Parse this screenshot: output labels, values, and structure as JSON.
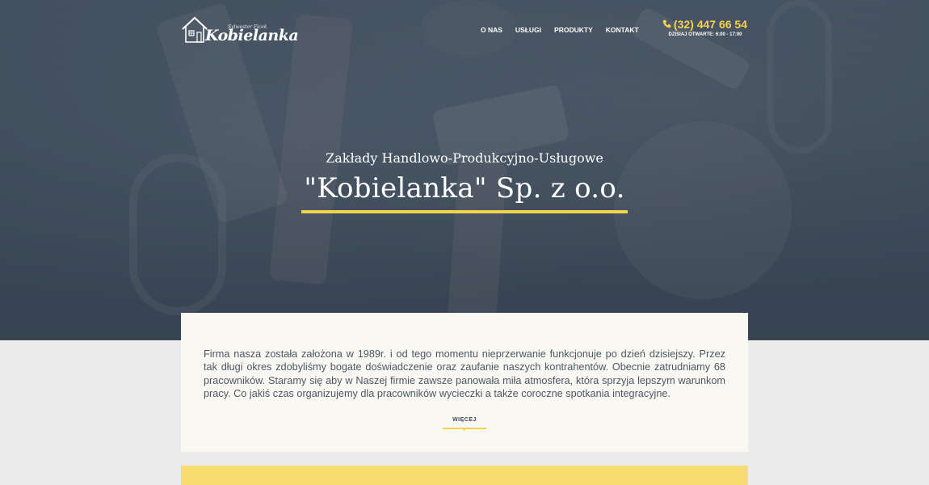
{
  "header": {
    "logo": {
      "subtitle": "Sylwester Ficek",
      "name": "Kobielanka",
      "icon": "house-icon"
    },
    "nav": [
      {
        "label": "O NAS"
      },
      {
        "label": "USŁUGI"
      },
      {
        "label": "PRODUKTY"
      },
      {
        "label": "KONTAKT"
      }
    ],
    "phone": {
      "icon": "phone-icon",
      "number": "(32) 447 66 54",
      "hours": "DZISIAJ OTWARTE: 6:00 - 17:00"
    }
  },
  "hero": {
    "subtitle": "Zakłady Handlowo-Produkcyjno-Usługowe",
    "title": "\"Kobielanka\" Sp. z o.o.",
    "accent_color": "#f3d24e"
  },
  "about": {
    "text": "Firma nasza została założona w 1989r. i od tego momentu nieprzerwanie funkcjonuje po dzień dzisiejszy. Przez tak długi okres zdobyliśmy bogate doświadczenie oraz zaufanie naszych kontrahentów. Obecnie zatrudniamy 68 pracowników. Staramy się aby w Naszej firmie zawsze panowała miła atmosfera, która sprzyja lepszym warunkom pracy. Co jakiś czas organizujemy dla pracowników wycieczki a także coroczne spotkania integracyjne.",
    "more_label": "WIĘCEJ"
  },
  "colors": {
    "accent": "#f3d24e",
    "hero_overlay": "#3f4c5b",
    "card_bg": "#f9f8f3",
    "page_bg": "#ececec"
  }
}
